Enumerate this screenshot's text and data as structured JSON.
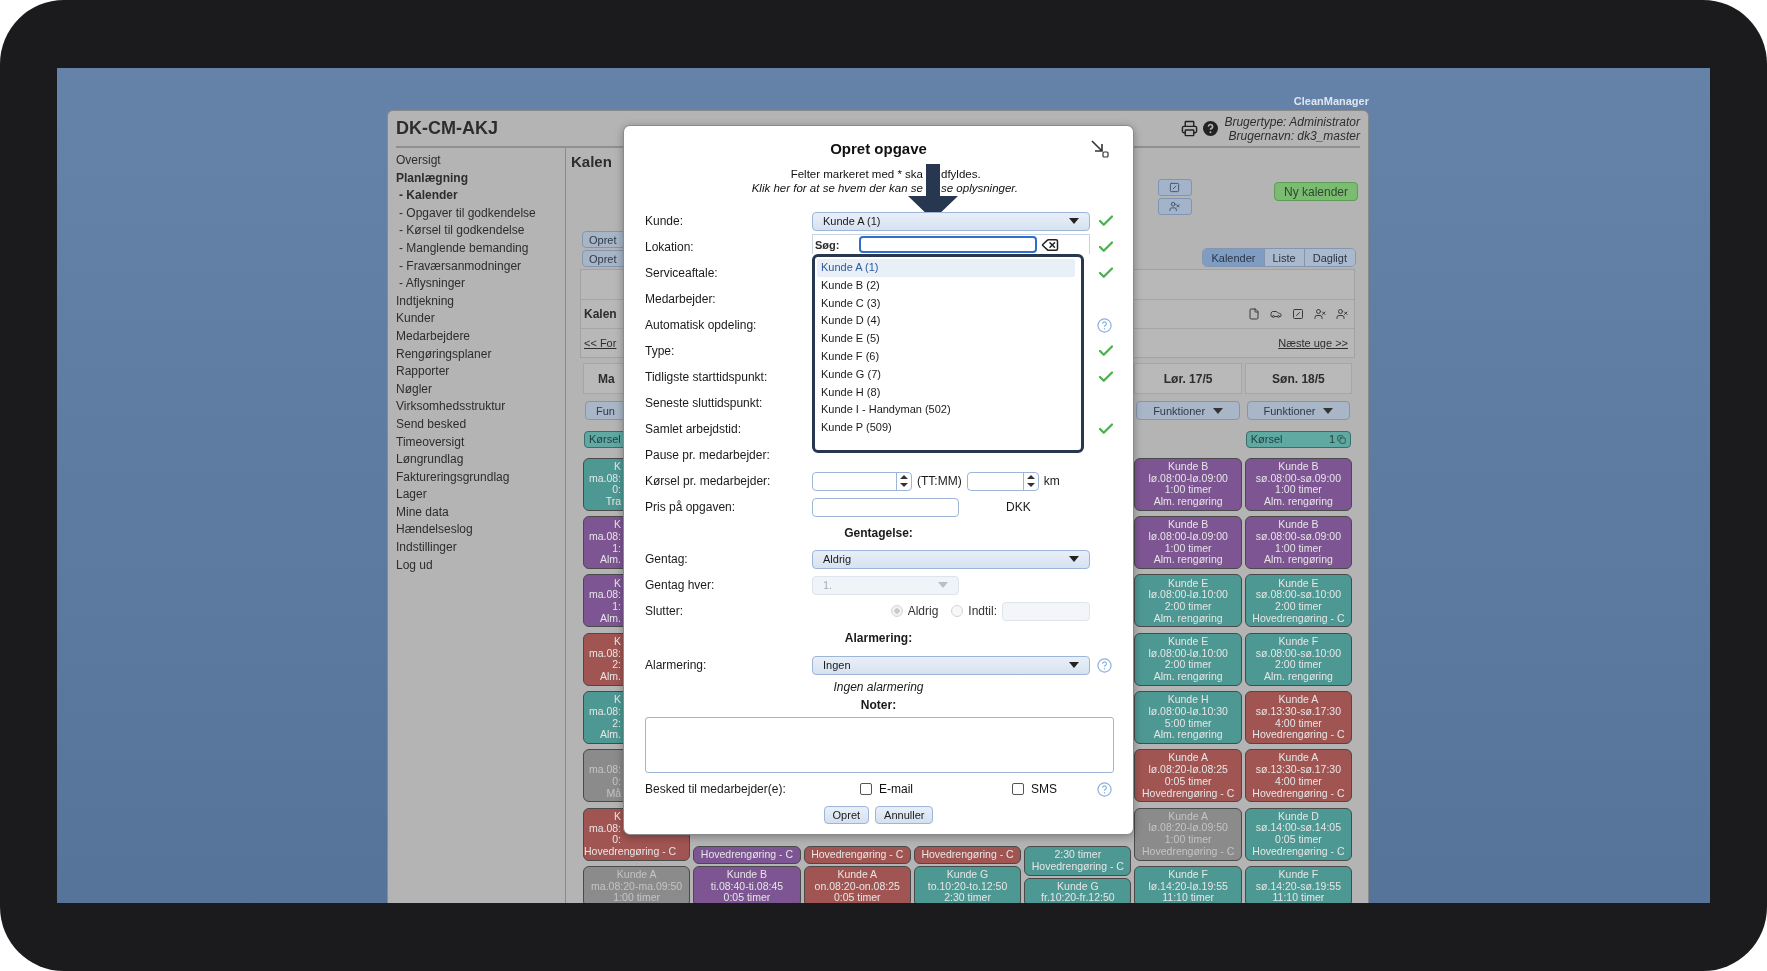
{
  "desktop_label": "CleanManager",
  "app": {
    "title": "DK-CM-AKJ",
    "user_type": "Brugertype: Administrator",
    "user_name": "Brugernavn: dk3_master"
  },
  "sidebar": {
    "items": [
      {
        "label": "Oversigt",
        "selected": false
      },
      {
        "label": "Planlægning",
        "selected": true,
        "children": [
          {
            "label": "- Kalender",
            "selected": true
          },
          {
            "label": "- Opgaver til godkendelse",
            "selected": false
          },
          {
            "label": "- Kørsel til godkendelse",
            "selected": false
          },
          {
            "label": "- Manglende bemanding",
            "selected": false
          },
          {
            "label": "- Fraværsanmodninger",
            "selected": false
          },
          {
            "label": "- Aflysninger",
            "selected": false
          }
        ]
      },
      {
        "label": "Indtjekning",
        "selected": false
      },
      {
        "label": "Kunder",
        "selected": false
      },
      {
        "label": "Medarbejdere",
        "selected": false
      },
      {
        "label": "Rengøringsplaner",
        "selected": false
      },
      {
        "label": "Rapporter",
        "selected": false
      },
      {
        "label": "Nøgler",
        "selected": false
      },
      {
        "label": "Virksomhedsstruktur",
        "selected": false
      },
      {
        "label": "Send besked",
        "selected": false
      },
      {
        "label": "Timeoversigt",
        "selected": false
      },
      {
        "label": "Løngrundlag",
        "selected": false
      },
      {
        "label": "Faktureringsgrundlag",
        "selected": false
      },
      {
        "label": "Lager",
        "selected": false
      },
      {
        "label": "Mine data",
        "selected": false
      },
      {
        "label": "Hændelseslog",
        "selected": false
      },
      {
        "label": "Indstillinger",
        "selected": false
      },
      {
        "label": "Log ud",
        "selected": false
      }
    ]
  },
  "content": {
    "title": "Kalen",
    "new_calendar": "Ny kalender",
    "create_buttons": [
      "Opret",
      "Opret"
    ],
    "view_tabs": [
      {
        "label": "Kalender",
        "selected": true
      },
      {
        "label": "Liste",
        "selected": false
      },
      {
        "label": "Dagligt",
        "selected": false
      }
    ],
    "panel": {
      "title": "Kalen",
      "prev_link": "<< For",
      "next_link": "Næste uge >>"
    }
  },
  "calendar": {
    "columns": [
      {
        "kind": "cut",
        "day": "Ma",
        "functions": "Fun",
        "korsel": {
          "label": "Kørsel"
        },
        "cards": [
          {
            "kind": "cut",
            "color": "#4e9893",
            "lines": [
              "K",
              "ma.08:",
              "0:",
              "Tra"
            ]
          },
          {
            "kind": "cut",
            "color": "#7d5592",
            "lines": [
              "K",
              "ma.08:",
              "1:",
              "Alm."
            ]
          },
          {
            "kind": "cut",
            "color": "#7d5592",
            "lines": [
              "K",
              "ma.08:",
              "1:",
              "Alm."
            ]
          },
          {
            "kind": "cut",
            "color": "#a05552",
            "lines": [
              "K",
              "ma.08:",
              "2:",
              "Alm."
            ]
          },
          {
            "kind": "cut",
            "color": "#4e9893",
            "lines": [
              "K",
              "ma.08:",
              "2:",
              "Alm."
            ]
          },
          {
            "kind": "cut",
            "color": "#8b8b8b",
            "lines": [
              "ma.08:",
              "0:",
              "Må"
            ]
          },
          {
            "kind": "cut",
            "color": "#a05552",
            "lines": [
              "K",
              "ma.08:",
              "0:",
              "Hovedrengøring - C"
            ]
          },
          {
            "kind": "full",
            "color": "#8b8b8b",
            "lines": [
              "Kunde A",
              "ma.08:20-ma.09:50",
              "1:00 timer"
            ]
          }
        ]
      },
      {
        "kind": "covered",
        "cards": [
          {
            "kind": "full",
            "color": "#7d5592",
            "lines": [
              "Hovedrengøring - C"
            ]
          },
          {
            "kind": "full",
            "color": "#7d5592",
            "lines": [
              "Kunde B",
              "ti.08:40-ti.08:45",
              "0:05 timer"
            ]
          }
        ]
      },
      {
        "kind": "covered",
        "cards": [
          {
            "kind": "full",
            "color": "#a05552",
            "lines": [
              "Hovedrengøring - C"
            ]
          },
          {
            "kind": "full",
            "color": "#a05552",
            "lines": [
              "Kunde A",
              "on.08:20-on.08:25",
              "0:05 timer"
            ]
          }
        ]
      },
      {
        "kind": "covered",
        "cards": [
          {
            "kind": "full",
            "color": "#a05552",
            "lines": [
              "Hovedrengøring - C"
            ]
          },
          {
            "kind": "full",
            "color": "#4e9893",
            "lines": [
              "Kunde G",
              "to.10:20-to.12:50",
              "2:30 timer"
            ]
          }
        ]
      },
      {
        "kind": "covered",
        "cards": [
          {
            "kind": "full",
            "color": "#4e9893",
            "lines": [
              "2:30 timer",
              "Hovedrengøring - C"
            ]
          },
          {
            "kind": "full",
            "color": "#4e9893",
            "lines": [
              "Kunde G",
              "fr.10:20-fr.12:50"
            ]
          }
        ]
      },
      {
        "kind": "full",
        "day": "Lør. 17/5",
        "functions": "Funktioner",
        "cards": [
          {
            "kind": "full",
            "color": "#7d5592",
            "lines": [
              "Kunde B",
              "lø.08:00-lø.09:00",
              "1:00 timer",
              "Alm. rengøring"
            ]
          },
          {
            "kind": "full",
            "color": "#7d5592",
            "lines": [
              "Kunde B",
              "lø.08:00-lø.09:00",
              "1:00 timer",
              "Alm. rengøring"
            ]
          },
          {
            "kind": "full",
            "color": "#4e9893",
            "lines": [
              "Kunde E",
              "lø.08:00-lø.10:00",
              "2:00 timer",
              "Alm. rengøring"
            ]
          },
          {
            "kind": "full",
            "color": "#4e9893",
            "lines": [
              "Kunde E",
              "lø.08:00-lø.10:00",
              "2:00 timer",
              "Alm. rengøring"
            ]
          },
          {
            "kind": "full",
            "color": "#4e9893",
            "lines": [
              "Kunde H",
              "lø.08:00-lø.10:30",
              "5:00 timer",
              "Alm. rengøring"
            ]
          },
          {
            "kind": "full",
            "color": "#a05552",
            "lines": [
              "Kunde A",
              "lø.08:20-lø.08:25",
              "0:05 timer",
              "Hovedrengøring - C"
            ]
          },
          {
            "kind": "full",
            "color": "#8b8b8b",
            "lines": [
              "Kunde A",
              "lø.08:20-lø.09:50",
              "1:00 timer",
              "Hovedrengøring - C"
            ]
          },
          {
            "kind": "full",
            "color": "#4e9893",
            "lines": [
              "Kunde F",
              "lø.14:20-lø.19:55",
              "11:10 timer"
            ]
          }
        ]
      },
      {
        "kind": "full",
        "day": "Søn. 18/5",
        "functions": "Funktioner",
        "korsel": {
          "label": "Kørsel",
          "count": "1"
        },
        "cards": [
          {
            "kind": "full",
            "color": "#7d5592",
            "lines": [
              "Kunde B",
              "sø.08:00-sø.09:00",
              "1:00 timer",
              "Alm. rengøring"
            ]
          },
          {
            "kind": "full",
            "color": "#7d5592",
            "lines": [
              "Kunde B",
              "sø.08:00-sø.09:00",
              "1:00 timer",
              "Alm. rengøring"
            ]
          },
          {
            "kind": "full",
            "color": "#4e9893",
            "lines": [
              "Kunde E",
              "sø.08:00-sø.10:00",
              "2:00 timer",
              "Hovedrengøring - C"
            ]
          },
          {
            "kind": "full",
            "color": "#4e9893",
            "lines": [
              "Kunde F",
              "sø.08:00-sø.10:00",
              "2:00 timer",
              "Alm. rengøring"
            ]
          },
          {
            "kind": "full",
            "color": "#a05552",
            "lines": [
              "Kunde A",
              "sø.13:30-sø.17:30",
              "4:00 timer",
              "Hovedrengøring - C"
            ]
          },
          {
            "kind": "full",
            "color": "#a05552",
            "lines": [
              "Kunde A",
              "sø.13:30-sø.17:30",
              "4:00 timer",
              "Hovedrengøring - C"
            ]
          },
          {
            "kind": "full",
            "color": "#4e9893",
            "lines": [
              "Kunde D",
              "sø.14:00-sø.14:05",
              "0:05 timer",
              "Hovedrengøring - C"
            ]
          },
          {
            "kind": "full",
            "color": "#4e9893",
            "lines": [
              "Kunde F",
              "sø.14:20-sø.19:55",
              "11:10 timer"
            ]
          }
        ]
      }
    ]
  },
  "dialog": {
    "title": "Opret opgave",
    "notes": [
      {
        "before": "Felter markeret med * ska",
        "after": "dfyldes."
      },
      {
        "before": "Klik her for at se hvem der kan se",
        "after": "se oplysninger."
      }
    ],
    "rows": [
      {
        "kind": "select",
        "label": "Kunde:",
        "select": {
          "value": "Kunde A (1)",
          "disabled": false
        },
        "check": true,
        "help": false
      },
      {
        "kind": "covered",
        "label": "Lokation:",
        "check": true,
        "help": false
      },
      {
        "kind": "covered",
        "label": "Serviceaftale:",
        "check": true,
        "help": false
      },
      {
        "kind": "covered",
        "label": "Medarbejder:",
        "check": false,
        "help": false
      },
      {
        "kind": "covered",
        "label": "Automatisk opdeling:",
        "check": false,
        "help": true
      },
      {
        "kind": "covered",
        "label": "Type:",
        "check": true,
        "help": false
      },
      {
        "kind": "covered",
        "label": "Tidligste starttidspunkt:",
        "check": true,
        "help": false
      },
      {
        "kind": "covered",
        "label": "Seneste sluttidspunkt:",
        "check": false,
        "help": false
      },
      {
        "kind": "covered",
        "label": "Samlet arbejdstid:",
        "check": true,
        "help": false
      },
      {
        "kind": "covered",
        "label": "Pause pr. medarbejder:",
        "check": false,
        "help": false
      },
      {
        "kind": "spinners",
        "label": "Kørsel pr. medarbejder:",
        "unit_1": "(TT:MM)",
        "unit_2": "km",
        "check": false,
        "help": false
      },
      {
        "kind": "price",
        "label": "Pris på opgaven:",
        "currency": "DKK",
        "check": false,
        "help": false
      },
      {
        "kind": "heading",
        "label": "Gentagelse:"
      },
      {
        "kind": "select",
        "label": "Gentag:",
        "select": {
          "value": "Aldrig",
          "disabled": false
        },
        "check": false,
        "help": false
      },
      {
        "kind": "select",
        "label": "Gentag hver:",
        "select": {
          "value": "1.",
          "disabled": true
        },
        "check": false,
        "help": false
      },
      {
        "kind": "radios",
        "label": "Slutter:",
        "disabled": true,
        "options": [
          {
            "label": "Aldrig",
            "selected": true
          },
          {
            "label": "Indtil:",
            "selected": false
          }
        ],
        "check": false,
        "help": false
      },
      {
        "kind": "heading",
        "label": "Alarmering:"
      },
      {
        "kind": "select",
        "label": "Alarmering:",
        "select": {
          "value": "Ingen",
          "disabled": false
        },
        "check": false,
        "help": true
      },
      {
        "kind": "hint",
        "label": "Ingen alarmering"
      },
      {
        "kind": "heading",
        "label": "Noter:"
      },
      {
        "kind": "textarea"
      },
      {
        "kind": "checkboxes",
        "label": "Besked til medarbejder(e):",
        "options": [
          {
            "label": "E-mail",
            "checked": false
          },
          {
            "label": "SMS",
            "checked": false
          }
        ],
        "check": false,
        "help": true
      }
    ],
    "buttons": [
      "Opret",
      "Annuller"
    ],
    "dropdown": {
      "search_label": "Søg:",
      "options": [
        {
          "label": "Kunde A (1)",
          "selected": true
        },
        {
          "label": "Kunde B (2)",
          "selected": false
        },
        {
          "label": "Kunde C (3)",
          "selected": false
        },
        {
          "label": "Kunde D (4)",
          "selected": false
        },
        {
          "label": "Kunde E (5)",
          "selected": false
        },
        {
          "label": "Kunde F (6)",
          "selected": false
        },
        {
          "label": "Kunde G (7)",
          "selected": false
        },
        {
          "label": "Kunde H (8)",
          "selected": false
        },
        {
          "label": "Kunde I - Handyman (502)",
          "selected": false
        },
        {
          "label": "Kunde P (509)",
          "selected": false
        }
      ]
    }
  }
}
